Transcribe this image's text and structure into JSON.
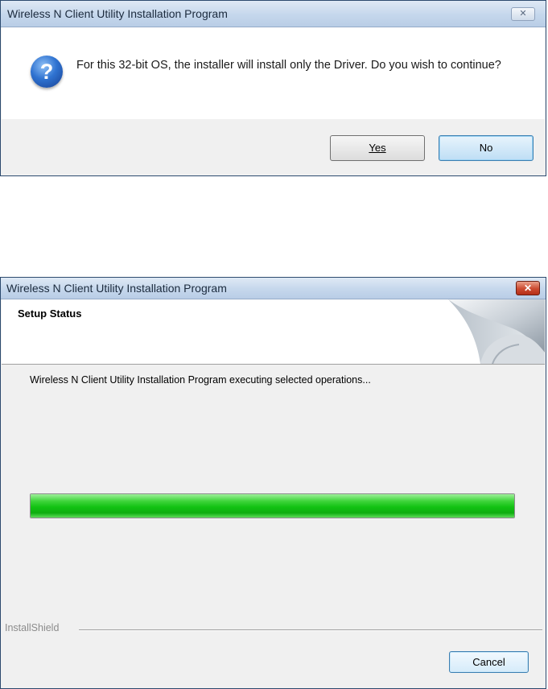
{
  "confirm_dialog": {
    "title": "Wireless N Client Utility Installation Program",
    "close_glyph": "✕",
    "icon": "question-icon",
    "icon_glyph": "?",
    "message": "For this 32-bit OS, the installer will install only the Driver. Do you wish to continue?",
    "yes_label": "Yes",
    "no_label": "No"
  },
  "setup_dialog": {
    "title": "Wireless N Client Utility Installation Program",
    "close_glyph": "✕",
    "header_title": "Setup Status",
    "status_text": "Wireless N Client Utility Installation Program executing selected operations...",
    "progress_fraction": 1.0,
    "brand_label": "InstallShield",
    "cancel_label": "Cancel"
  }
}
